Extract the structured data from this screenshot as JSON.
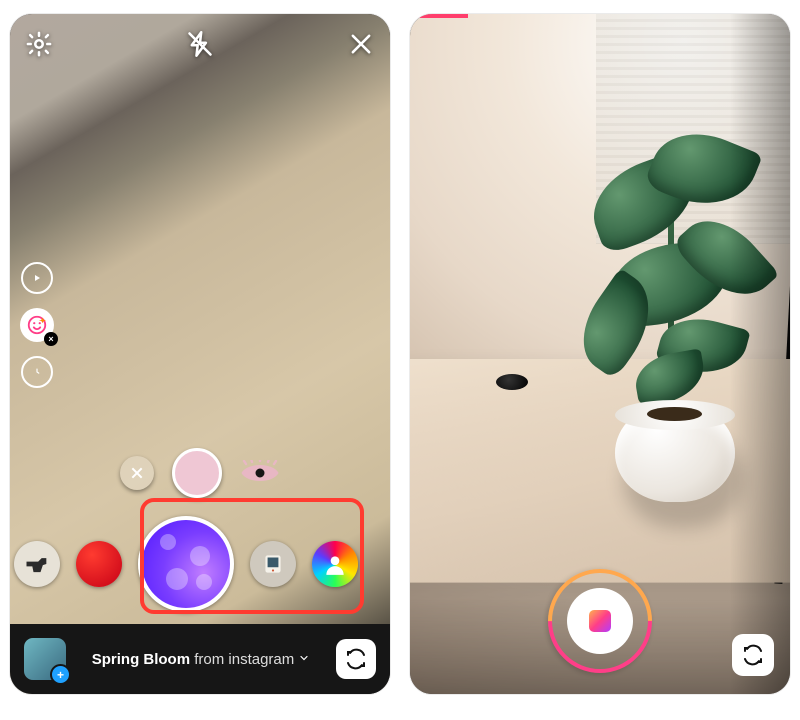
{
  "left": {
    "top": {
      "settings_icon": "gear-icon",
      "flash_icon": "flash-off-icon",
      "close_icon": "close-icon"
    },
    "side_tools": {
      "play_icon": "play-icon",
      "face_filter_icon": "face-filter-icon",
      "face_filter_x": "×",
      "timer_icon": "timer-icon"
    },
    "tweak_row": {
      "reset_icon": "close-icon",
      "intensity_icon": "circle-icon",
      "preview_icon": "eye-icon"
    },
    "effects": [
      {
        "name": "squirt-gun",
        "icon": "squirt-gun-icon"
      },
      {
        "name": "red-dot",
        "icon": "red-dot-icon"
      },
      {
        "name": "spring-bloom",
        "icon": "bloom-icon",
        "selected": true
      },
      {
        "name": "polaroid",
        "icon": "polaroid-icon"
      },
      {
        "name": "rainbow-person",
        "icon": "rainbow-icon"
      }
    ],
    "footer": {
      "gallery_icon": "gallery-thumbnail",
      "gallery_plus": "+",
      "effect_name": "Spring Bloom",
      "effect_from_word": " from ",
      "effect_author": "instagram",
      "chevron_icon": "chevron-down-icon",
      "switch_camera_icon": "switch-camera-icon"
    },
    "annotation": "selected-effect-highlight"
  },
  "right": {
    "progress_value": "recording",
    "shutter": {
      "ring_icon": "record-ring-icon",
      "stop_icon": "stop-icon"
    },
    "switch_camera_icon": "switch-camera-icon"
  }
}
